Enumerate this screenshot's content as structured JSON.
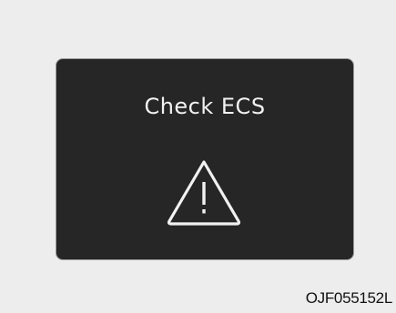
{
  "display": {
    "message": "Check ECS",
    "icon": "warning-triangle-icon",
    "background_color": "#262626",
    "text_color": "#f2f2f2"
  },
  "figure": {
    "code": "OJF055152L"
  }
}
